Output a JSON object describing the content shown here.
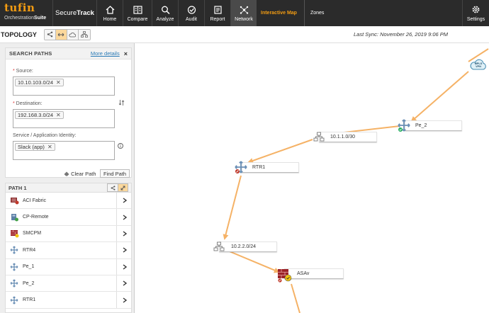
{
  "brand": {
    "name": "tufin",
    "suite_prefix": "Orchestration",
    "suite_bold": "Suite",
    "product_light": "Secure",
    "product_bold": "Track"
  },
  "nav": [
    {
      "label": "Home",
      "icon": "home-icon"
    },
    {
      "label": "Compare",
      "icon": "compare-icon"
    },
    {
      "label": "Analyze",
      "icon": "magnifier-icon"
    },
    {
      "label": "Audit",
      "icon": "check-circle-icon"
    },
    {
      "label": "Report",
      "icon": "report-icon"
    },
    {
      "label": "Network",
      "icon": "network-icon",
      "active": true
    }
  ],
  "subnav": {
    "active": "Interactive Map",
    "other": "Zones"
  },
  "settings_label": "Settings",
  "toolbar": {
    "title": "TOPOLOGY",
    "last_sync": "Last Sync: November 26, 2019 9:06 PM"
  },
  "search": {
    "title": "SEARCH PATHS",
    "more_details": "More details",
    "close": "×",
    "source_label": "Source:",
    "source_value": "10.10.103.0/24",
    "destination_label": "Destination:",
    "destination_value": "192.168.3.0/24",
    "service_label": "Service / Application Identity:",
    "service_value": "Slack (app)",
    "clear_path": "Clear Path",
    "find_path": "Find Path"
  },
  "path": {
    "title": "PATH 1",
    "items": [
      {
        "name": "ACI Fabric",
        "icon": "aci-fabric-icon"
      },
      {
        "name": "CP-Remote",
        "icon": "checkpoint-icon"
      },
      {
        "name": "SMCPM",
        "icon": "firewall-icon"
      },
      {
        "name": "RTR4",
        "icon": "router-icon"
      },
      {
        "name": "Pe_1",
        "icon": "router-icon"
      },
      {
        "name": "Pe_2",
        "icon": "router-icon"
      },
      {
        "name": "RTR1",
        "icon": "router-icon"
      }
    ]
  },
  "map": {
    "nodes": {
      "mpls": "MPLS VPN",
      "pe2": "Pe_2",
      "net1": "10.1.1.0/30",
      "rtr1": "RTR1",
      "net2": "10.2.2.0/24",
      "asav": "ASAv"
    },
    "colors": {
      "path": "#f5b266",
      "accent": "#f39c12"
    }
  }
}
